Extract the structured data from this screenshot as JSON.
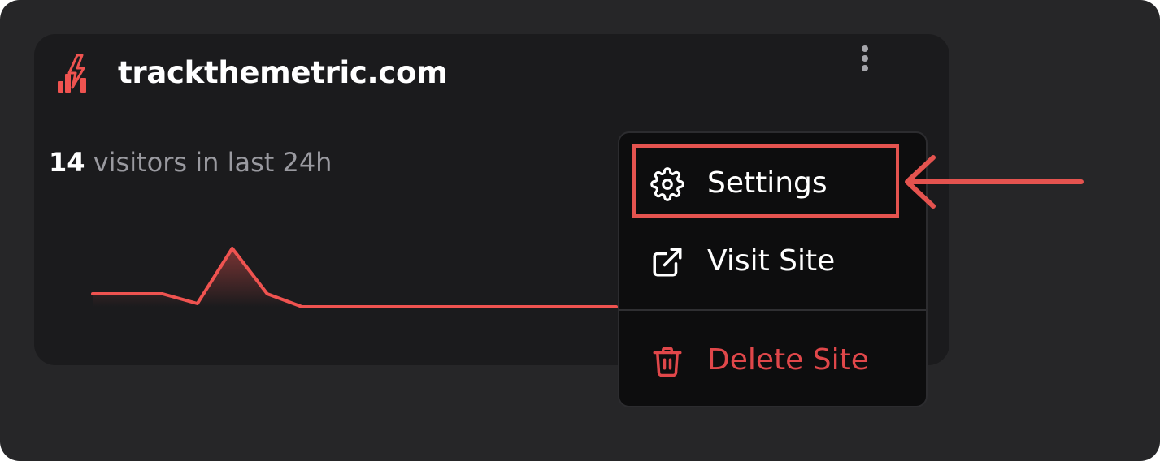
{
  "site": {
    "name": "trackthemetric.com",
    "logo_icon": "bar-chart-lightning-logo-icon"
  },
  "stats": {
    "visitor_count": "14",
    "visitor_label": "visitors in last 24h"
  },
  "sparkline": {
    "color": "#ef5350",
    "values": [
      4,
      4,
      4,
      1,
      18,
      4,
      0,
      0,
      0,
      0,
      0,
      0,
      0,
      0,
      0,
      0
    ]
  },
  "menu": {
    "items": [
      {
        "label": "Settings",
        "icon": "gear-icon"
      },
      {
        "label": "Visit Site",
        "icon": "external-link-icon"
      },
      {
        "label": "Delete Site",
        "icon": "trash-icon"
      }
    ]
  },
  "annotation": {
    "highlight_color": "#e4534f"
  },
  "colors": {
    "accent": "#ef5350",
    "danger": "#e0474a",
    "card_bg": "#1b1b1d",
    "menu_bg": "#0d0d0e"
  }
}
